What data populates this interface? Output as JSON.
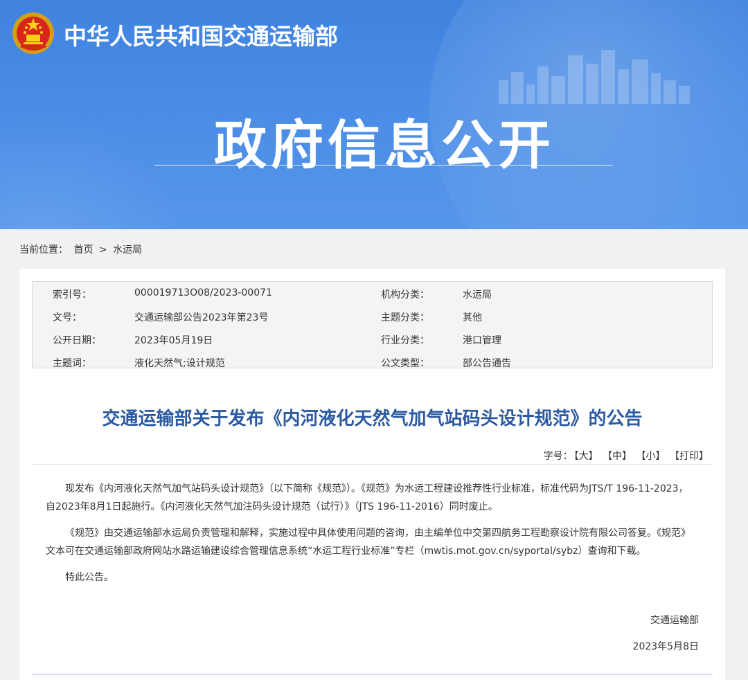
{
  "header": {
    "ministry_name": "中华人民共和国交通运输部",
    "banner_title": "政府信息公开",
    "brand_color": "#3f83df"
  },
  "breadcrumb": {
    "label": "当前位置：",
    "home": "首页",
    "separator": ">",
    "current": "水运局"
  },
  "meta": {
    "rows": [
      {
        "label_left": "索引号：",
        "value_left": "000019713O08/2023-00071",
        "label_right": "机构分类：",
        "value_right": "水运局"
      },
      {
        "label_left": "文号：",
        "value_left": "交通运输部公告2023年第23号",
        "label_right": "主题分类：",
        "value_right": "其他"
      },
      {
        "label_left": "公开日期：",
        "value_left": "2023年05月19日",
        "label_right": "行业分类：",
        "value_right": "港口管理"
      },
      {
        "label_left": "主题词：",
        "value_left": "液化天然气;设计规范",
        "label_right": "公文类型：",
        "value_right": "部公告通告"
      }
    ]
  },
  "article": {
    "title": "交通运输部关于发布《内河液化天然气加气站码头设计规范》的公告",
    "font_size_label": "字号：",
    "tools": [
      "【大】",
      "【中】",
      "【小】",
      "【打印】"
    ],
    "paragraphs": [
      "现发布《内河液化天然气加气站码头设计规范》（以下简称《规范》）。《规范》为水运工程建设推荐性行业标准，标准代码为JTS/T 196-11-2023，自2023年8月1日起施行。《内河液化天然气加注码头设计规范（试行）》（JTS 196-11-2016）同时废止。",
      "《规范》由交通运输部水运局负责管理和解释，实施过程中具体使用问题的咨询，由主编单位中交第四航务工程勘察设计院有限公司答复。《规范》文本可在交通运输部政府网站水路运输建设综合管理信息系统“水运工程行业标准”专栏（mwtis.mot.gov.cn/syportal/sybz）查询和下载。",
      "特此公告。"
    ],
    "signature": "交通运输部",
    "date": "2023年5月8日",
    "title_color": "#2b5aa0"
  }
}
